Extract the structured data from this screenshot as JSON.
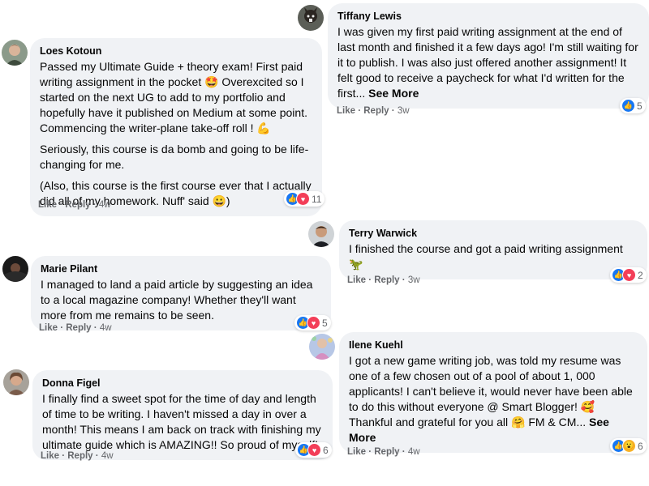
{
  "actions": {
    "like": "Like",
    "reply": "Reply"
  },
  "comments": [
    {
      "name": "Loes Kotoun",
      "paragraphs": [
        "Passed my Ultimate Guide + theory exam! First paid writing assignment in the pocket 🤩 Overexcited so I started on the next UG to add to my portfolio and hopefully have it published on Medium at some point. Commencing the writer-plane take-off roll ! 💪",
        "Seriously, this course is da bomb and going to be life-changing for me.",
        "(Also, this course is the first course ever that I actually did all of my homework. Nuff' said 😀)"
      ],
      "time": "4w",
      "reactions": "11"
    },
    {
      "name": "Tiffany Lewis",
      "text": "I was given my first paid writing assignment at the end of last month and finished it a few days ago! I'm still waiting for it to publish. I was also just offered another assignment! It felt good to receive a paycheck for what I'd written for the first...",
      "see_more": "See More",
      "time": "3w",
      "reactions": "5"
    },
    {
      "name": "Terry Warwick",
      "text": "I finished the course and got a paid writing assignment 🦖",
      "time": "3w",
      "reactions": "2"
    },
    {
      "name": "Marie Pilant",
      "text": "I managed to land a paid article by suggesting an idea to a local magazine company! Whether they'll want more from me remains to be seen.",
      "time": "4w",
      "reactions": "5"
    },
    {
      "name": "Ilene Kuehl",
      "text": "I got a new game writing job, was told my resume was one of a few chosen out of a pool of about 1, 000 applicants! I can't believe it, would never have been able to do this without everyone @ Smart Blogger! 🥰 Thankful and grateful for you all 🤗 FM & CM...",
      "see_more": "See More",
      "time": "4w",
      "reactions": "6"
    },
    {
      "name": "Donna Figel",
      "text": "I finally find a sweet spot for the time of day and length of time to be writing. I haven't missed a day in over a month! This means I am back on track with finishing my ultimate guide which is AMAZING!! So proud of myself!",
      "time": "4w",
      "reactions": "6"
    }
  ],
  "colors": {
    "bubble": "#f0f2f5",
    "meta": "#65676b",
    "like": "#1877f2",
    "love": "#f33e58",
    "wow": "#f7b125"
  }
}
